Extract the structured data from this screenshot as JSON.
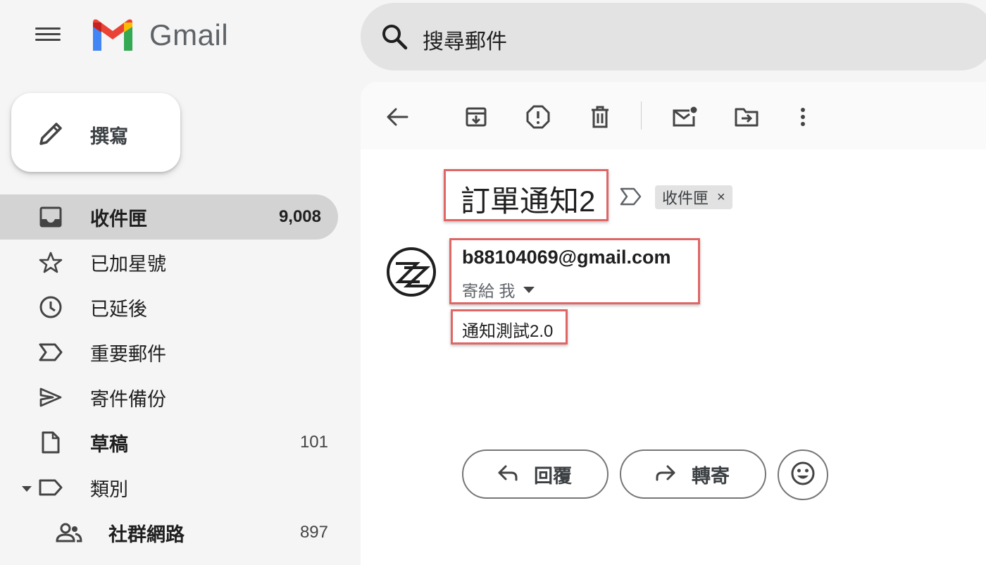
{
  "app": {
    "brand": "Gmail"
  },
  "search": {
    "placeholder": "搜尋郵件"
  },
  "compose": {
    "label": "撰寫"
  },
  "sidebar": {
    "items": [
      {
        "label": "收件匣",
        "count": "9,008",
        "icon": "inbox-icon",
        "active": true
      },
      {
        "label": "已加星號",
        "count": "",
        "icon": "star-icon"
      },
      {
        "label": "已延後",
        "count": "",
        "icon": "clock-icon"
      },
      {
        "label": "重要郵件",
        "count": "",
        "icon": "important-icon"
      },
      {
        "label": "寄件備份",
        "count": "",
        "icon": "send-icon"
      },
      {
        "label": "草稿",
        "count": "101",
        "icon": "draft-icon"
      },
      {
        "label": "類別",
        "count": "",
        "icon": "label-icon"
      },
      {
        "label": "社群網路",
        "count": "897",
        "icon": "people-icon"
      }
    ]
  },
  "toolbar": {
    "icons": [
      "back-icon",
      "archive-icon",
      "report-spam-icon",
      "delete-icon",
      "mark-unread-icon",
      "move-to-icon",
      "more-vert-icon"
    ]
  },
  "message": {
    "subject": "訂單通知2",
    "label_chip": "收件匣",
    "label_close": "×",
    "sender": "b88104069@gmail.com",
    "to": "寄給 我",
    "body": "通知測試2.0"
  },
  "actions": {
    "reply": "回覆",
    "forward": "轉寄"
  },
  "colors": {
    "highlight": "#e06666",
    "active_nav": "#d3d3d3",
    "search_bg": "#e3e3e3"
  }
}
